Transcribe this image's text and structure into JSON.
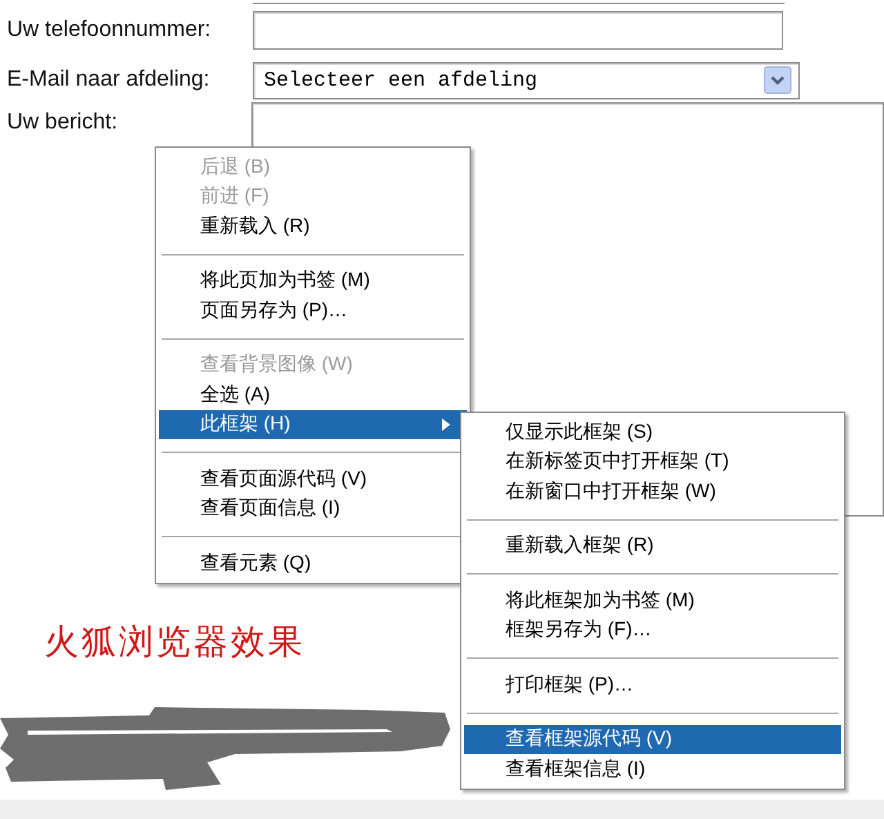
{
  "form": {
    "fields": [
      {
        "label": "Uw telefoonnummer:",
        "kind": "text"
      },
      {
        "label": "E-Mail naar afdeling:",
        "kind": "select",
        "value": "Selecteer een afdeling"
      },
      {
        "label": "Uw bericht:",
        "kind": "textarea"
      }
    ]
  },
  "context_menu": {
    "items": [
      {
        "kind": "item",
        "label": "后退 (B)",
        "disabled": true,
        "selected": false
      },
      {
        "kind": "item",
        "label": "前进 (F)",
        "disabled": true,
        "selected": false
      },
      {
        "kind": "item",
        "label": "重新载入 (R)",
        "disabled": false,
        "selected": false
      },
      {
        "kind": "separator"
      },
      {
        "kind": "item",
        "label": "将此页加为书签 (M)",
        "disabled": false,
        "selected": false
      },
      {
        "kind": "item",
        "label": "页面另存为 (P)…",
        "disabled": false,
        "selected": false
      },
      {
        "kind": "separator"
      },
      {
        "kind": "item",
        "label": "查看背景图像 (W)",
        "disabled": true,
        "selected": false
      },
      {
        "kind": "item",
        "label": "全选 (A)",
        "disabled": false,
        "selected": false
      },
      {
        "kind": "submenu",
        "label": "此框架 (H)",
        "disabled": false,
        "selected": true
      },
      {
        "kind": "separator"
      },
      {
        "kind": "item",
        "label": "查看页面源代码 (V)",
        "disabled": false,
        "selected": false
      },
      {
        "kind": "item",
        "label": "查看页面信息 (I)",
        "disabled": false,
        "selected": false
      },
      {
        "kind": "separator"
      },
      {
        "kind": "item",
        "label": "查看元素 (Q)",
        "disabled": false,
        "selected": false
      }
    ]
  },
  "submenu": {
    "items": [
      {
        "kind": "item",
        "label": "仅显示此框架 (S)",
        "disabled": false,
        "selected": false
      },
      {
        "kind": "item",
        "label": "在新标签页中打开框架 (T)",
        "disabled": false,
        "selected": false
      },
      {
        "kind": "item",
        "label": "在新窗口中打开框架 (W)",
        "disabled": false,
        "selected": false
      },
      {
        "kind": "separator"
      },
      {
        "kind": "item",
        "label": "重新载入框架 (R)",
        "disabled": false,
        "selected": false
      },
      {
        "kind": "separator"
      },
      {
        "kind": "item",
        "label": "将此框架加为书签 (M)",
        "disabled": false,
        "selected": false
      },
      {
        "kind": "item",
        "label": "框架另存为 (F)…",
        "disabled": false,
        "selected": false
      },
      {
        "kind": "separator"
      },
      {
        "kind": "item",
        "label": "打印框架 (P)…",
        "disabled": false,
        "selected": false
      },
      {
        "kind": "separator"
      },
      {
        "kind": "item",
        "label": "查看框架源代码 (V)",
        "disabled": false,
        "selected": true
      },
      {
        "kind": "item",
        "label": "查看框架信息 (I)",
        "disabled": false,
        "selected": false
      }
    ]
  },
  "caption": "火狐浏览器效果"
}
